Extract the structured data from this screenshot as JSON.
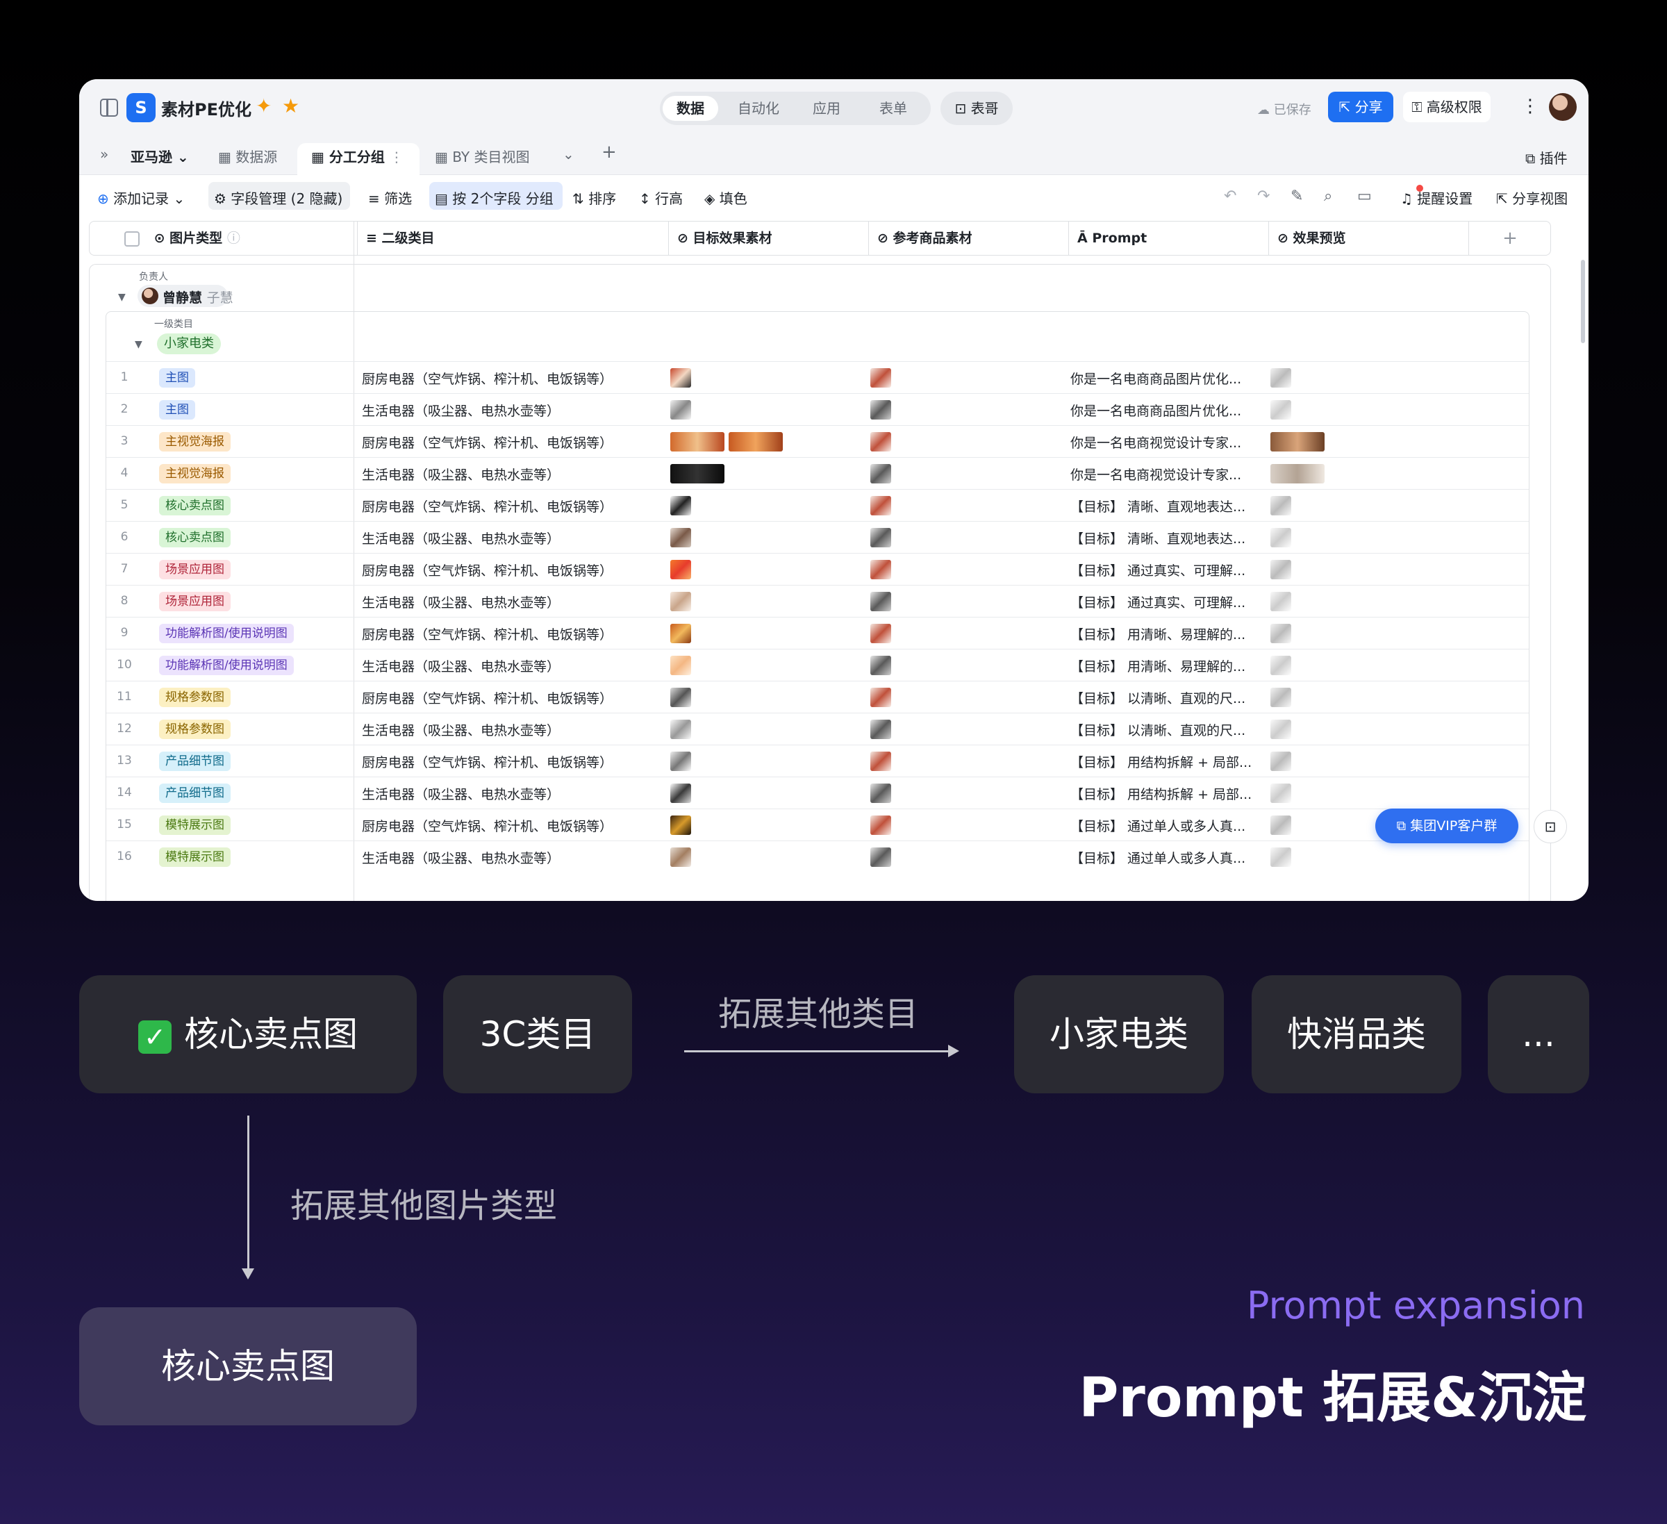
{
  "app": {
    "title": "素材PE优化",
    "view_tabs": [
      "数据",
      "自动化",
      "应用",
      "表单"
    ],
    "bot_label": "表哥",
    "saved_label": "已保存",
    "share_label": "分享",
    "advanced_label": "高级权限"
  },
  "tabs": {
    "workspace": "亚马逊",
    "items": [
      "数据源",
      "分工分组",
      "BY 类目视图"
    ],
    "plugin_label": "插件"
  },
  "toolbar": {
    "add_record": "添加记录",
    "field_manage": "字段管理 (2 隐藏)",
    "filter": "筛选",
    "group": "按 2个字段 分组",
    "sort": "排序",
    "row_height": "行高",
    "fill": "填色",
    "reminder": "提醒设置",
    "share_view": "分享视图"
  },
  "table": {
    "columns": [
      "图片类型",
      "二级类目",
      "目标效果素材",
      "参考商品素材",
      "Prompt",
      "效果预览"
    ],
    "group_owner_label": "负责人",
    "owner_name": "曾静慧",
    "owner_sub": "子慧",
    "group_category_label": "一级类目",
    "category": "小家电类",
    "rows": [
      {
        "num": "1",
        "type": "主图",
        "sub": "厨房电器（空气炸锅、榨汁机、电饭锅等）",
        "prompt": "你是一名电商商品图片优化..."
      },
      {
        "num": "2",
        "type": "主图",
        "sub": "生活电器（吸尘器、电热水壶等）",
        "prompt": "你是一名电商商品图片优化..."
      },
      {
        "num": "3",
        "type": "主视觉海报",
        "sub": "厨房电器（空气炸锅、榨汁机、电饭锅等）",
        "prompt": "你是一名电商视觉设计专家..."
      },
      {
        "num": "4",
        "type": "主视觉海报",
        "sub": "生活电器（吸尘器、电热水壶等）",
        "prompt": "你是一名电商视觉设计专家..."
      },
      {
        "num": "5",
        "type": "核心卖点图",
        "sub": "厨房电器（空气炸锅、榨汁机、电饭锅等）",
        "prompt": "【目标】 清晰、直观地表达..."
      },
      {
        "num": "6",
        "type": "核心卖点图",
        "sub": "生活电器（吸尘器、电热水壶等）",
        "prompt": "【目标】 清晰、直观地表达..."
      },
      {
        "num": "7",
        "type": "场景应用图",
        "sub": "厨房电器（空气炸锅、榨汁机、电饭锅等）",
        "prompt": "【目标】 通过真实、可理解..."
      },
      {
        "num": "8",
        "type": "场景应用图",
        "sub": "生活电器（吸尘器、电热水壶等）",
        "prompt": "【目标】 通过真实、可理解..."
      },
      {
        "num": "9",
        "type": "功能解析图/使用说明图",
        "sub": "厨房电器（空气炸锅、榨汁机、电饭锅等）",
        "prompt": "【目标】 用清晰、易理解的..."
      },
      {
        "num": "10",
        "type": "功能解析图/使用说明图",
        "sub": "生活电器（吸尘器、电热水壶等）",
        "prompt": "【目标】 用清晰、易理解的..."
      },
      {
        "num": "11",
        "type": "规格参数图",
        "sub": "厨房电器（空气炸锅、榨汁机、电饭锅等）",
        "prompt": "【目标】 以清晰、直观的尺..."
      },
      {
        "num": "12",
        "type": "规格参数图",
        "sub": "生活电器（吸尘器、电热水壶等）",
        "prompt": "【目标】 以清晰、直观的尺..."
      },
      {
        "num": "13",
        "type": "产品细节图",
        "sub": "厨房电器（空气炸锅、榨汁机、电饭锅等）",
        "prompt": "【目标】 用结构拆解 + 局部..."
      },
      {
        "num": "14",
        "type": "产品细节图",
        "sub": "生活电器（吸尘器、电热水壶等）",
        "prompt": "【目标】 用结构拆解 + 局部..."
      },
      {
        "num": "15",
        "type": "模特展示图",
        "sub": "厨房电器（空气炸锅、榨汁机、电饭锅等）",
        "prompt": "【目标】 通过单人或多人真..."
      },
      {
        "num": "16",
        "type": "模特展示图",
        "sub": "生活电器（吸尘器、电热水壶等）",
        "prompt": "【目标】 通过单人或多人真..."
      }
    ]
  },
  "floating": {
    "vip_label": "集团VIP客户群"
  },
  "diagram": {
    "source_card": "核心卖点图",
    "category_card": "3C类目",
    "expand_category_label": "拓展其他类目",
    "target_cards": [
      "小家电类",
      "快消品类",
      "..."
    ],
    "expand_type_label": "拓展其他图片类型",
    "result_card": "核心卖点图"
  },
  "footer": {
    "subtitle_en": "Prompt expansion",
    "title_cn": "Prompt 拓展&沉淀"
  },
  "colors": {
    "accent_blue": "#1e6ff1",
    "purple": "#8b6cf2",
    "tag_blue": "#dbe8fd",
    "tag_orange": "#fde6c8",
    "tag_green": "#d9f5d6",
    "tag_pink": "#fde0e3",
    "tag_purple": "#ece3fd",
    "tag_yellow": "#fcf0c3",
    "tag_cyan": "#d6f0fa"
  }
}
